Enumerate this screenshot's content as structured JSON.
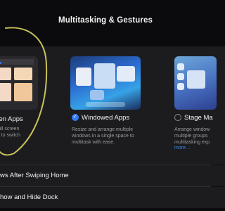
{
  "header": {
    "title": "Multitasking & Gestures"
  },
  "options": [
    {
      "label": "reen Apps",
      "description": "s full screen\nme to switch",
      "selected": false
    },
    {
      "label": "Windowed Apps",
      "description": "Resize and arrange multiple\nwindows in a single space to\nmultitask with ease.",
      "selected": true
    },
    {
      "label": "Stage Ma",
      "description": "Arrange window\nmultiple groups\nmultitasking exp",
      "more": "more…",
      "selected": false
    }
  ],
  "rows": [
    {
      "label": "ws After Swiping Home"
    },
    {
      "label": "how and Hide Dock"
    }
  ],
  "colors": {
    "background": "#0b0b0d",
    "panel": "#1c1c1f",
    "accent": "#2f7cf6",
    "annotation": "#c8c25a"
  }
}
